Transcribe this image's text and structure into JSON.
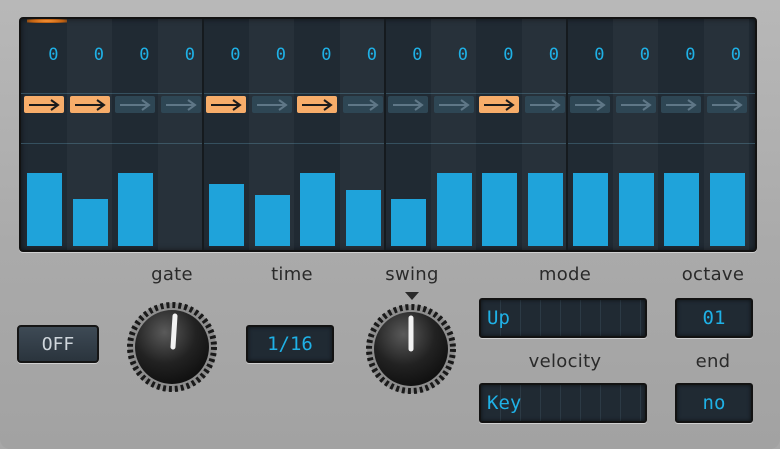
{
  "sequencer": {
    "step_values": [
      "0",
      "0",
      "0",
      "0",
      "0",
      "0",
      "0",
      "0",
      "0",
      "0",
      "0",
      "0",
      "0",
      "0",
      "0",
      "0"
    ],
    "tie_on": [
      true,
      true,
      false,
      false,
      true,
      false,
      true,
      false,
      false,
      false,
      true,
      false,
      false,
      false,
      false,
      false
    ],
    "velocity_levels": [
      0.47,
      0.3,
      0.47,
      0,
      0.4,
      0.33,
      0.47,
      0.36,
      0.3,
      0.47,
      0.47,
      0.47,
      0.47,
      0.47,
      0.47,
      0.47
    ]
  },
  "controls": {
    "on_off": "OFF",
    "gate_label": "gate",
    "time_label": "time",
    "time_value": "1/16",
    "swing_label": "swing",
    "mode_label": "mode",
    "mode_value": "Up",
    "octave_label": "octave",
    "octave_value": "01",
    "velocity_label": "velocity",
    "velocity_value": "Key",
    "end_label": "end",
    "end_value": "no"
  },
  "colors": {
    "lcd_text": "#1fb1e6",
    "tie_active": "#f7ad6a",
    "bar": "#1fa3da",
    "panel": "#aaaaaa",
    "display_bg": "#202a33"
  }
}
